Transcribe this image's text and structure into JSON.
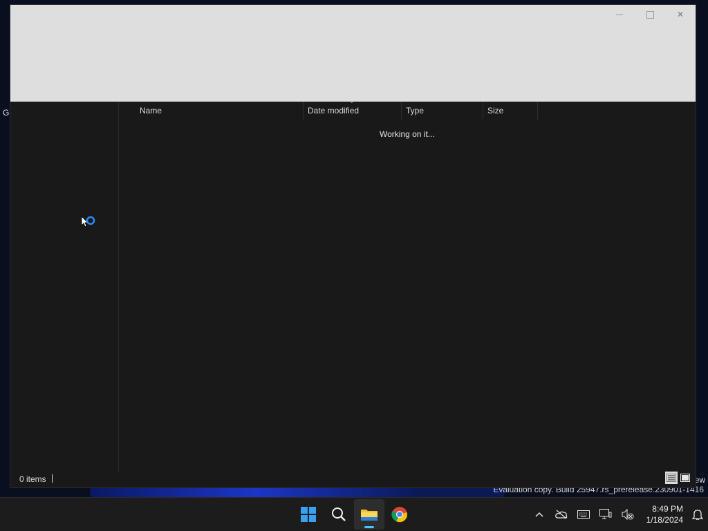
{
  "desktop": {
    "left_fragment": "Go",
    "right_fragment": "ew",
    "evaluation_text": "Evaluation copy. Build 25947.rs_prerelease.230901-1416"
  },
  "window": {
    "columns": {
      "name": "Name",
      "date_modified": "Date modified",
      "type": "Type",
      "size": "Size"
    },
    "working_text": "Working on it...",
    "status": {
      "item_count": "0 items"
    }
  },
  "taskbar": {
    "apps": [
      "start-icon",
      "search-icon",
      "file-explorer-icon",
      "chrome-icon"
    ],
    "clock": {
      "time": "8:49 PM",
      "date": "1/18/2024"
    }
  },
  "colors": {
    "accent": "#4cc2ff",
    "window_bg": "#191919",
    "titlebar_bg": "#dedede",
    "taskbar_bg": "#1c1c1c"
  }
}
